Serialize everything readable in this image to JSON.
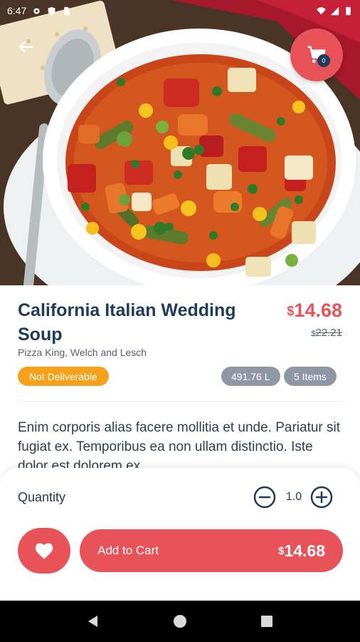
{
  "status_bar": {
    "time": "6:47",
    "icons": [
      "gear-icon",
      "shield-icon",
      "sim-card-icon",
      "wifi-icon",
      "signal-icon",
      "battery-icon"
    ]
  },
  "header": {
    "back_icon": "arrow-left-icon",
    "cart_icon": "shopping-cart-icon",
    "cart_count": "0"
  },
  "product": {
    "name": "California Italian Wedding Soup",
    "store": "Pizza King, Welch and Lesch",
    "currency": "$",
    "price": "14.68",
    "old_price": "22.21",
    "delivery_badge": "Not Deliverable",
    "capacity": "491.76 L",
    "items": "5 Items",
    "description": "Enim corporis alias facere mollitia et unde. Pariatur sit fugiat ex. Temporibus ea non ullam distinctio. Iste dolor est dolorem ex."
  },
  "quantity": {
    "label": "Quantity",
    "value": "1.0",
    "minus_icon": "minus-circle-icon",
    "plus_icon": "plus-circle-icon"
  },
  "actions": {
    "favorite_icon": "heart-icon",
    "add_to_cart_label": "Add to Cart",
    "total_currency": "$",
    "total_price": "14.68"
  },
  "colors": {
    "accent": "#e8535a",
    "navy": "#1f3a5c",
    "orange": "#f5a11b",
    "pill_gray": "#8f97a4"
  },
  "nav_bar": {
    "icons": [
      "back-triangle-icon",
      "home-circle-icon",
      "recents-square-icon"
    ]
  }
}
